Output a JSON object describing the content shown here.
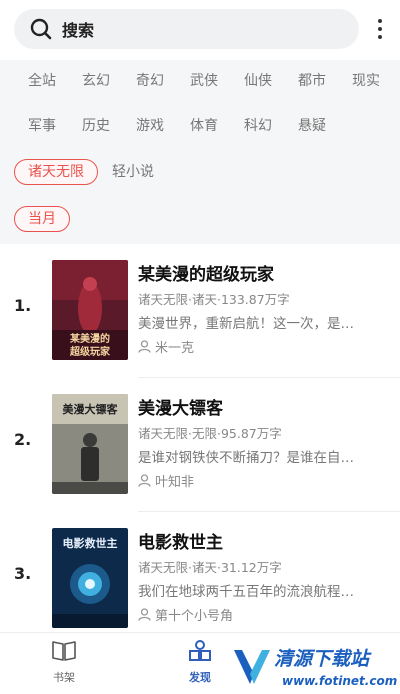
{
  "search": {
    "label": "搜索"
  },
  "categories": [
    "全站",
    "玄幻",
    "奇幻",
    "武侠",
    "仙侠",
    "都市",
    "现实",
    "军事",
    "历史",
    "游戏",
    "体育",
    "科幻",
    "悬疑"
  ],
  "subcategories": {
    "selected": "诸天无限",
    "other": "轻小说"
  },
  "period": {
    "selected": "当月"
  },
  "books": [
    {
      "rank": "1.",
      "title": "某美漫的超级玩家",
      "meta": "诸天无限·诸天·133.87万字",
      "desc": "美漫世界，重新启航！这一次，是…",
      "author": "米一克",
      "cover_text": "某美漫的超级玩家",
      "cover_bg": "#5a1a2a"
    },
    {
      "rank": "2.",
      "title": "美漫大镖客",
      "meta": "诸天无限·无限·95.87万字",
      "desc": "是谁对钢铁侠不断捅刀？是谁在自…",
      "author": "叶知非",
      "cover_text": "美漫大镖客",
      "cover_bg": "#6b6a63"
    },
    {
      "rank": "3.",
      "title": "电影救世主",
      "meta": "诸天无限·诸天·31.12万字",
      "desc": "我们在地球两千五百年的流浪航程…",
      "author": "第十个小号角",
      "cover_text": "电影救世主",
      "cover_bg": "#0e2a4a"
    }
  ],
  "bottom_nav": [
    {
      "label": "书架",
      "icon": "book-icon",
      "active": false
    },
    {
      "label": "发现",
      "icon": "discover-icon",
      "active": true
    }
  ],
  "watermark": {
    "title": "清源下载站",
    "url": "www.fotinet.com"
  },
  "colors": {
    "accent": "#e8534f",
    "nav_active": "#2f5fb8"
  }
}
